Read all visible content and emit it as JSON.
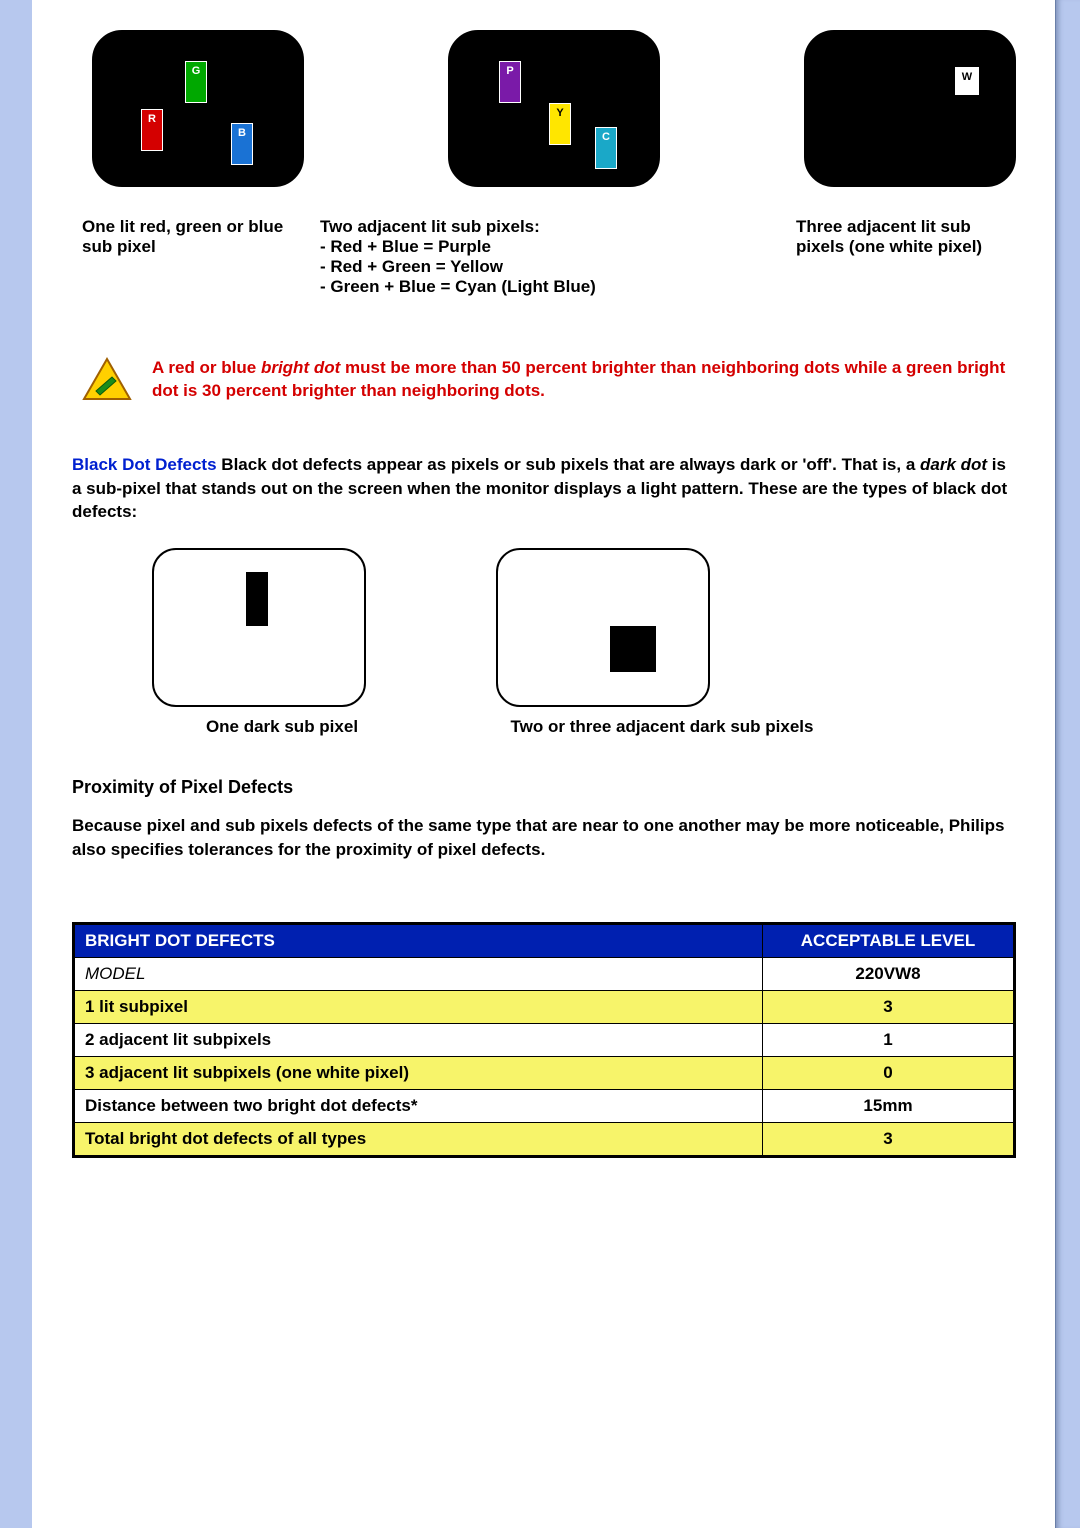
{
  "figures": {
    "fig1": {
      "r": "R",
      "g": "G",
      "b": "B"
    },
    "fig2": {
      "p": "P",
      "y": "Y",
      "c": "C"
    },
    "fig3": {
      "w": "W"
    },
    "caption1": "One lit red, green or blue sub pixel",
    "caption2_title": "Two adjacent lit sub pixels:",
    "caption2_l1": "- Red + Blue = Purple",
    "caption2_l2": "- Red + Green = Yellow",
    "caption2_l3": "- Green + Blue = Cyan (Light Blue)",
    "caption3": "Three adjacent lit sub pixels (one white pixel)"
  },
  "note": {
    "part1": "A red or blue ",
    "ital": "bright dot",
    "part2": " must be more than 50 percent brighter than neighboring dots while a green bright dot is 30 percent brighter than neighboring dots."
  },
  "black_dot": {
    "lead": "Black Dot Defects",
    "body1": " Black dot defects appear as pixels or sub pixels that are always dark or 'off'. That is, a ",
    "ital": "dark dot",
    "body2": " is a sub-pixel that stands out on the screen when the monitor displays a light pattern. These are the types of black dot defects:"
  },
  "dark_captions": {
    "one": "One dark sub pixel",
    "two": "Two or three adjacent dark sub pixels"
  },
  "proximity": {
    "heading": "Proximity of Pixel Defects",
    "body": "Because pixel and sub pixels defects of the same type that are near to one another may be more noticeable, Philips also specifies tolerances for the proximity of pixel defects."
  },
  "table": {
    "header_left": "BRIGHT DOT DEFECTS",
    "header_right": "ACCEPTABLE LEVEL",
    "rows": [
      {
        "label": "MODEL",
        "value": "220VW8",
        "cls": "model plain"
      },
      {
        "label": "1 lit subpixel",
        "value": "3",
        "cls": "alt"
      },
      {
        "label": "2 adjacent lit subpixels",
        "value": "1",
        "cls": "plain"
      },
      {
        "label": "3 adjacent lit subpixels (one white pixel)",
        "value": "0",
        "cls": "alt"
      },
      {
        "label": "Distance between two bright dot defects*",
        "value": "15mm",
        "cls": "plain"
      },
      {
        "label": "Total bright dot defects of all types",
        "value": "3",
        "cls": "alt"
      }
    ]
  }
}
